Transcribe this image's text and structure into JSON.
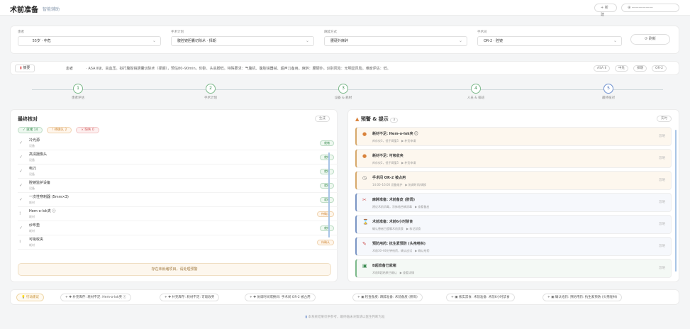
{
  "header": {
    "title": "术前准备",
    "subtitle": "智能辅助",
    "new_label": "+ 新建",
    "user_label": "⊕ ——————"
  },
  "selectors": [
    {
      "label": "患者",
      "value": "　　 55岁 · 中危"
    },
    {
      "label": "手术计划",
      "value": "腹腔镜胆囊切除术 · 择期"
    },
    {
      "label": "麻醉方式",
      "value": "腰硬外麻醉"
    },
    {
      "label": "手术间",
      "value": "OR-2 · 腔镜"
    }
  ],
  "refresh_label": "⟳ 刷新",
  "summary": {
    "tag": "摘要",
    "text": "患者 　　　 · ASA Ⅱ级、高血压。拟行腹腔镜胆囊切除术（择期），预估80–90min。仰卧、头高脚低。特殊要求：气腹机、腹腔镜器械、超声刀备用。麻醉：腰硬外。识别风险：无明显风险。难度评估：低。",
    "chips": [
      "ASA Ⅱ",
      "中危",
      "择期",
      "OR-2"
    ]
  },
  "steps": [
    {
      "num": "1",
      "label": "患者评估"
    },
    {
      "num": "2",
      "label": "手术计划"
    },
    {
      "num": "3",
      "label": "设备 & 耗材"
    },
    {
      "num": "4",
      "label": "人员 & 排班"
    },
    {
      "num": "5",
      "label": "最终核对"
    }
  ],
  "left": {
    "title": "最终核对",
    "badge": "生成",
    "filters": {
      "ok": "✓ 就绪 14",
      "warn": "! 待确认 2",
      "miss": "× 缺失 0"
    },
    "items": [
      {
        "mark": "✓",
        "name": "冷光源",
        "sub": "设备",
        "status": "就绪",
        "kind": "ok"
      },
      {
        "mark": "✓",
        "name": "高清摄像头",
        "sub": "设备",
        "status": "就绪",
        "kind": "ok"
      },
      {
        "mark": "✓",
        "name": "电刀",
        "sub": "设备",
        "status": "就绪",
        "kind": "ok"
      },
      {
        "mark": "✓",
        "name": "腔镜监护设备",
        "sub": "设备",
        "status": "就绪",
        "kind": "ok"
      },
      {
        "mark": "✓",
        "name": "一次性穿刺器 (5mm×3)",
        "sub": "耗材",
        "status": "就绪",
        "kind": "ok"
      },
      {
        "mark": "!",
        "name": "Hem-o-lok夹 ⓘ",
        "sub": "耗材",
        "status": "待确认",
        "kind": "warn"
      },
      {
        "mark": "✓",
        "name": "纱布垫",
        "sub": "耗材",
        "status": "就绪",
        "kind": "ok"
      },
      {
        "mark": "!",
        "name": "可吸收夹",
        "sub": "耗材",
        "status": "待确认",
        "kind": "warn"
      }
    ],
    "footnote": "存在未就绪项目，请处理预警"
  },
  "right": {
    "title": "预警 & 提示",
    "count": "3",
    "badge": "实时",
    "alerts": [
      {
        "icon": "●",
        "color": "#d9823b",
        "title": "耗材不足: Hem-o-lok夹 ⓘ",
        "desc": "库存仅3，低于阈值5　▶ 补货申请",
        "kind": "orange",
        "action": "忽略"
      },
      {
        "icon": "●",
        "color": "#d9823b",
        "title": "耗材不足: 可吸收夹",
        "desc": "库存仅2，低于阈值5　▶ 补货申请",
        "kind": "orange",
        "action": "忽略"
      },
      {
        "icon": "◷",
        "color": "#777777",
        "title": "手术间 OR-2 被占用",
        "desc": "14:00–16:00 设备维护　▶ 协调时间/调换",
        "kind": "orange",
        "action": "忽略"
      },
      {
        "icon": "✂",
        "color": "#d05757",
        "title": "麻醉准备: 术前备皮 (脐周)",
        "desc": "建议术前消毒，涂抹络合碘消毒　▶ 查看备皮",
        "kind": "blue",
        "action": "忽略"
      },
      {
        "icon": "⌛",
        "color": "#8a7bc4",
        "title": "术前准备: 术前6小时禁食",
        "desc": "确认患者已遵嘱术前禁食　▶ 标记禁食",
        "kind": "blue",
        "action": "忽略"
      },
      {
        "icon": "✎",
        "color": "#d05757",
        "title": "预防用药: 抗生素预防 (头孢唑林)",
        "desc": "术前30–60分钟给药，确认皮试　▶ 确认给药",
        "kind": "blue",
        "action": "忽略"
      },
      {
        "icon": "▣",
        "color": "#3a8b50",
        "title": "B超准备已就绪",
        "desc": "术前B超结果已确认　▶ 查看详情",
        "kind": "green",
        "action": "忽略"
      }
    ]
  },
  "bottom_chips": [
    "💡 行动建议",
    "+ ✚ 补充库存: 耗材不足: Hem-o-lok夹 ⓘ",
    "+ ✚ 补充库存: 耗材不足: 可吸收夹",
    "+ ✚ 协调时间或换间: 手术间 OR-2 被占用",
    "+ ▣ 检查备皮: 麻醉准备: 术前备皮 (脐周)",
    "+ ▣ 核实禁食: 术前准备: 术前6小时禁食",
    "+ ▣ 确认给药: 预防用药: 抗生素预防 (头孢唑林)"
  ],
  "footer": "本系统结果仅供参考，最终临床决策请以医生判断为准"
}
